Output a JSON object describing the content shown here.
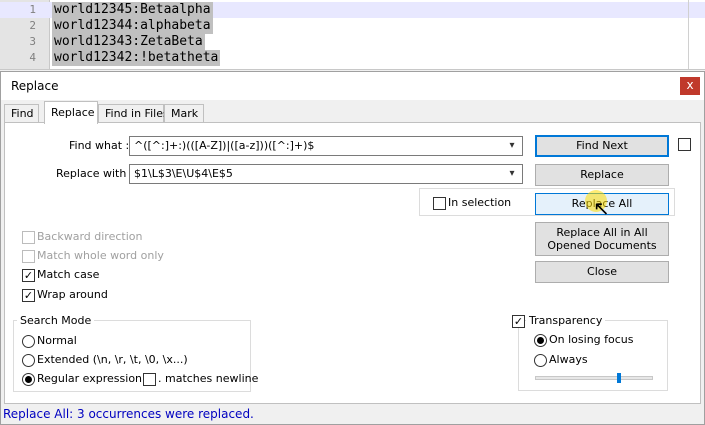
{
  "editor": {
    "lines": [
      {
        "num": "1",
        "text": "world12345:Betaalpha"
      },
      {
        "num": "2",
        "text": "world12344:alphabeta"
      },
      {
        "num": "3",
        "text": "world12343:ZetaBeta"
      },
      {
        "num": "4",
        "text": "world12342:!betatheta"
      }
    ]
  },
  "dialog": {
    "title": "Replace",
    "close_glyph": "x",
    "tabs": [
      "Find",
      "Replace",
      "Find in Files",
      "Mark"
    ],
    "active_tab": "Replace",
    "find_what_label": "Find what :",
    "find_what_value": "^([^:]+:)(([A-Z])|([a-z]))([^:]+)$",
    "replace_with_label": "Replace with :",
    "replace_with_value": "$1\\L$3\\E\\U$4\\E$5",
    "in_selection_label": "In selection",
    "buttons": {
      "find_next": "Find Next",
      "replace": "Replace",
      "replace_all": "Replace All",
      "replace_all_opened": "Replace All in All Opened Documents",
      "close": "Close"
    },
    "options": {
      "backward_direction": "Backward direction",
      "match_whole_word": "Match whole word only",
      "match_case": "Match case",
      "wrap_around": "Wrap around"
    },
    "search_mode": {
      "legend": "Search Mode",
      "normal": "Normal",
      "extended": "Extended (\\n, \\r, \\t, \\0, \\x...)",
      "regex": "Regular expression",
      "matches_newline": ". matches newline"
    },
    "transparency": {
      "legend": "Transparency",
      "on_losing_focus": "On losing focus",
      "always": "Always",
      "slider_level": 0.72
    },
    "status": "Replace All: 3 occurrences were replaced.",
    "colors": {
      "accent": "#0078d7",
      "status_text": "#0000c0",
      "close_red": "#c0392b"
    }
  }
}
